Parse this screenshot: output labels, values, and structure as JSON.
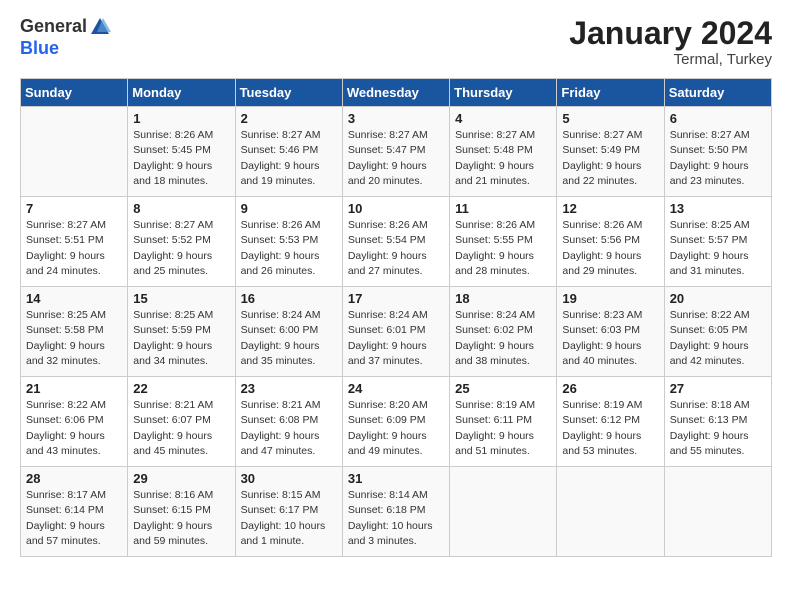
{
  "header": {
    "logo_general": "General",
    "logo_blue": "Blue",
    "month_title": "January 2024",
    "location": "Termal, Turkey"
  },
  "days_of_week": [
    "Sunday",
    "Monday",
    "Tuesday",
    "Wednesday",
    "Thursday",
    "Friday",
    "Saturday"
  ],
  "weeks": [
    [
      {
        "day": "",
        "info": ""
      },
      {
        "day": "1",
        "info": "Sunrise: 8:26 AM\nSunset: 5:45 PM\nDaylight: 9 hours\nand 18 minutes."
      },
      {
        "day": "2",
        "info": "Sunrise: 8:27 AM\nSunset: 5:46 PM\nDaylight: 9 hours\nand 19 minutes."
      },
      {
        "day": "3",
        "info": "Sunrise: 8:27 AM\nSunset: 5:47 PM\nDaylight: 9 hours\nand 20 minutes."
      },
      {
        "day": "4",
        "info": "Sunrise: 8:27 AM\nSunset: 5:48 PM\nDaylight: 9 hours\nand 21 minutes."
      },
      {
        "day": "5",
        "info": "Sunrise: 8:27 AM\nSunset: 5:49 PM\nDaylight: 9 hours\nand 22 minutes."
      },
      {
        "day": "6",
        "info": "Sunrise: 8:27 AM\nSunset: 5:50 PM\nDaylight: 9 hours\nand 23 minutes."
      }
    ],
    [
      {
        "day": "7",
        "info": "Sunrise: 8:27 AM\nSunset: 5:51 PM\nDaylight: 9 hours\nand 24 minutes."
      },
      {
        "day": "8",
        "info": "Sunrise: 8:27 AM\nSunset: 5:52 PM\nDaylight: 9 hours\nand 25 minutes."
      },
      {
        "day": "9",
        "info": "Sunrise: 8:26 AM\nSunset: 5:53 PM\nDaylight: 9 hours\nand 26 minutes."
      },
      {
        "day": "10",
        "info": "Sunrise: 8:26 AM\nSunset: 5:54 PM\nDaylight: 9 hours\nand 27 minutes."
      },
      {
        "day": "11",
        "info": "Sunrise: 8:26 AM\nSunset: 5:55 PM\nDaylight: 9 hours\nand 28 minutes."
      },
      {
        "day": "12",
        "info": "Sunrise: 8:26 AM\nSunset: 5:56 PM\nDaylight: 9 hours\nand 29 minutes."
      },
      {
        "day": "13",
        "info": "Sunrise: 8:25 AM\nSunset: 5:57 PM\nDaylight: 9 hours\nand 31 minutes."
      }
    ],
    [
      {
        "day": "14",
        "info": "Sunrise: 8:25 AM\nSunset: 5:58 PM\nDaylight: 9 hours\nand 32 minutes."
      },
      {
        "day": "15",
        "info": "Sunrise: 8:25 AM\nSunset: 5:59 PM\nDaylight: 9 hours\nand 34 minutes."
      },
      {
        "day": "16",
        "info": "Sunrise: 8:24 AM\nSunset: 6:00 PM\nDaylight: 9 hours\nand 35 minutes."
      },
      {
        "day": "17",
        "info": "Sunrise: 8:24 AM\nSunset: 6:01 PM\nDaylight: 9 hours\nand 37 minutes."
      },
      {
        "day": "18",
        "info": "Sunrise: 8:24 AM\nSunset: 6:02 PM\nDaylight: 9 hours\nand 38 minutes."
      },
      {
        "day": "19",
        "info": "Sunrise: 8:23 AM\nSunset: 6:03 PM\nDaylight: 9 hours\nand 40 minutes."
      },
      {
        "day": "20",
        "info": "Sunrise: 8:22 AM\nSunset: 6:05 PM\nDaylight: 9 hours\nand 42 minutes."
      }
    ],
    [
      {
        "day": "21",
        "info": "Sunrise: 8:22 AM\nSunset: 6:06 PM\nDaylight: 9 hours\nand 43 minutes."
      },
      {
        "day": "22",
        "info": "Sunrise: 8:21 AM\nSunset: 6:07 PM\nDaylight: 9 hours\nand 45 minutes."
      },
      {
        "day": "23",
        "info": "Sunrise: 8:21 AM\nSunset: 6:08 PM\nDaylight: 9 hours\nand 47 minutes."
      },
      {
        "day": "24",
        "info": "Sunrise: 8:20 AM\nSunset: 6:09 PM\nDaylight: 9 hours\nand 49 minutes."
      },
      {
        "day": "25",
        "info": "Sunrise: 8:19 AM\nSunset: 6:11 PM\nDaylight: 9 hours\nand 51 minutes."
      },
      {
        "day": "26",
        "info": "Sunrise: 8:19 AM\nSunset: 6:12 PM\nDaylight: 9 hours\nand 53 minutes."
      },
      {
        "day": "27",
        "info": "Sunrise: 8:18 AM\nSunset: 6:13 PM\nDaylight: 9 hours\nand 55 minutes."
      }
    ],
    [
      {
        "day": "28",
        "info": "Sunrise: 8:17 AM\nSunset: 6:14 PM\nDaylight: 9 hours\nand 57 minutes."
      },
      {
        "day": "29",
        "info": "Sunrise: 8:16 AM\nSunset: 6:15 PM\nDaylight: 9 hours\nand 59 minutes."
      },
      {
        "day": "30",
        "info": "Sunrise: 8:15 AM\nSunset: 6:17 PM\nDaylight: 10 hours\nand 1 minute."
      },
      {
        "day": "31",
        "info": "Sunrise: 8:14 AM\nSunset: 6:18 PM\nDaylight: 10 hours\nand 3 minutes."
      },
      {
        "day": "",
        "info": ""
      },
      {
        "day": "",
        "info": ""
      },
      {
        "day": "",
        "info": ""
      }
    ]
  ]
}
